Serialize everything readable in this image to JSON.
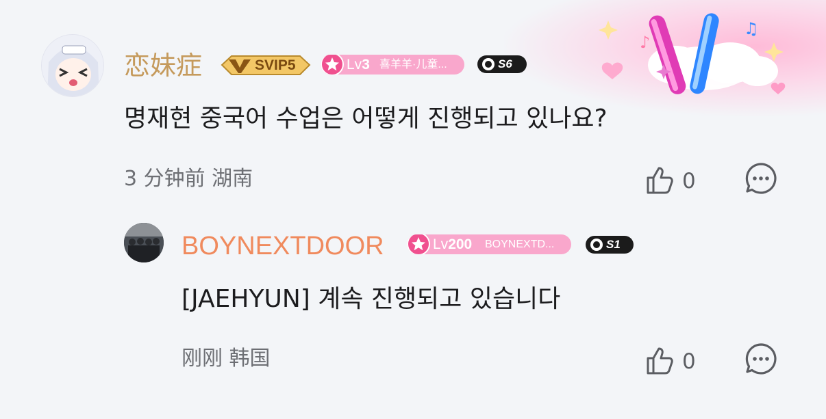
{
  "comments": [
    {
      "username": "恋妹症",
      "svip": "SVIP5",
      "level": {
        "prefix": "Lv",
        "number": "3",
        "tag": "喜羊羊·儿童..."
      },
      "season": "S6",
      "text": "명재현 중국어 수업은 어떻게 진행되고 있나요?",
      "meta": "3 分钟前 湖南",
      "likes": "0"
    }
  ],
  "replies": [
    {
      "username": "BOYNEXTDOOR",
      "level": {
        "prefix": "Lv",
        "number": "200",
        "tag": "BOYNEXTD..."
      },
      "season": "S1",
      "text": "[JAEHYUN] 계속 진행되고 있습니다",
      "meta": "刚刚 韩国",
      "likes": "0"
    }
  ],
  "colors": {
    "background": "#f3f5f8",
    "username_gold": "#c59a5c",
    "username_orange": "#f08a5d",
    "level_pink": "#f9a7cc",
    "text": "#1c1c1e",
    "meta": "#6d6f74"
  },
  "icons": [
    "thumbs-up-icon",
    "comment-bubble-icon",
    "star-badge-icon",
    "svip-crown-icon",
    "lightstick-decoration"
  ]
}
